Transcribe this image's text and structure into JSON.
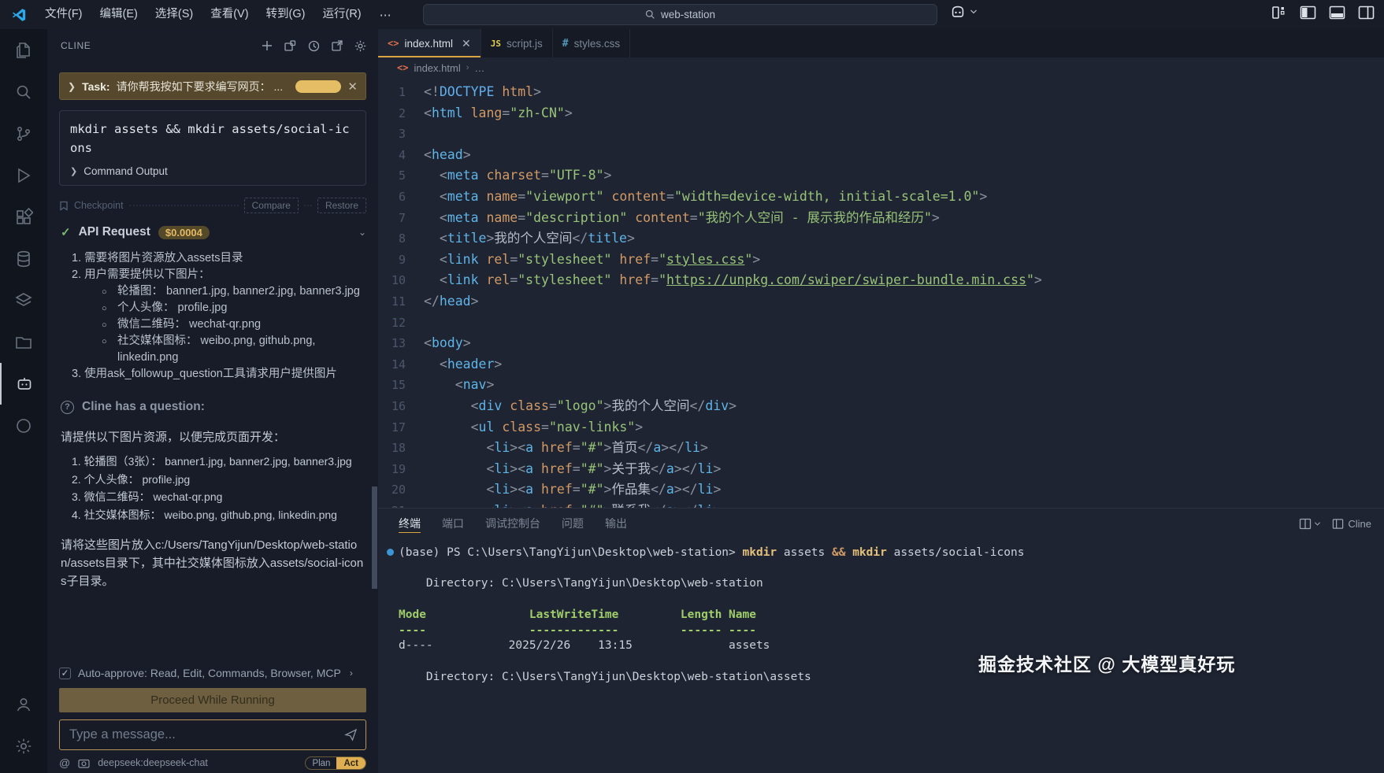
{
  "titlebar": {
    "menus": [
      "文件(F)",
      "编辑(E)",
      "选择(S)",
      "查看(V)",
      "转到(G)",
      "运行(R)"
    ],
    "more_label": "⋯",
    "search_value": "web-station"
  },
  "sidebar": {
    "title": "CLINE",
    "task": {
      "chevron": "❯",
      "label": "Task:",
      "text": "请你帮我按如下要求编写网页： ...",
      "cost_badge": "",
      "close": "✕"
    },
    "command": {
      "text": "mkdir assets && mkdir assets/social-icons",
      "output_chevron": "❯",
      "output_label": "Command Output"
    },
    "checkpoint": {
      "label": "Checkpoint",
      "compare": "Compare",
      "restore": "Restore"
    },
    "api_request": {
      "check": "✓",
      "label": "API Request",
      "cost": "$0.0004",
      "chevron": "⌄"
    },
    "plan_lines": [
      {
        "kind": "num",
        "text": "1. 需要将图片资源放入assets目录"
      },
      {
        "kind": "num",
        "text": "2. 用户需要提供以下图片："
      },
      {
        "kind": "bullet",
        "text": "轮播图： banner1.jpg, banner2.jpg, banner3.jpg"
      },
      {
        "kind": "bullet",
        "text": "个人头像： profile.jpg"
      },
      {
        "kind": "bullet",
        "text": "微信二维码： wechat-qr.png"
      },
      {
        "kind": "bullet",
        "text": "社交媒体图标： weibo.png, github.png, linkedin.png"
      },
      {
        "kind": "num",
        "text": "3. 使用ask_followup_question工具请求用户提供图片"
      }
    ],
    "question": {
      "icon": "?",
      "title": "Cline has a question:",
      "intro": "请提供以下图片资源，以便完成页面开发：",
      "items": [
        "1. 轮播图（3张）： banner1.jpg, banner2.jpg, banner3.jpg",
        "2. 个人头像： profile.jpg",
        "3. 微信二维码： wechat-qr.png",
        "4. 社交媒体图标： weibo.png, github.png, linkedin.png"
      ],
      "footer": "请将这些图片放入c:/Users/TangYijun/Desktop/web-station/assets目录下，其中社交媒体图标放入assets/social-icons子目录。"
    },
    "auto_approve": {
      "check": "✓",
      "label": "Auto-approve: Read, Edit, Commands, Browser, MCP",
      "chevron": "›"
    },
    "proceed_button": "Proceed While Running",
    "input_placeholder": "Type a message...",
    "footer": {
      "at": "@",
      "model": "deepseek:deepseek-chat",
      "plan": "Plan",
      "act": "Act"
    }
  },
  "editor": {
    "tabs": [
      {
        "label": "index.html",
        "icon": "html",
        "active": true,
        "close": "✕"
      },
      {
        "label": "script.js",
        "icon": "js",
        "active": false
      },
      {
        "label": "styles.css",
        "icon": "css",
        "active": false
      }
    ],
    "breadcrumb": {
      "icon": "html",
      "file": "index.html",
      "sep": "›",
      "more": "…"
    },
    "code_lines": [
      {
        "n": "1",
        "toks": [
          [
            "p",
            "<!"
          ],
          [
            "k",
            "DOCTYPE"
          ],
          [
            "a",
            " html"
          ],
          [
            "p",
            ">"
          ]
        ]
      },
      {
        "n": "2",
        "toks": [
          [
            "p",
            "<"
          ],
          [
            "t",
            "html"
          ],
          [
            "a",
            " lang"
          ],
          [
            "p",
            "="
          ],
          [
            "s",
            "\"zh-CN\""
          ],
          [
            "p",
            ">"
          ]
        ]
      },
      {
        "n": "3",
        "toks": []
      },
      {
        "n": "4",
        "toks": [
          [
            "p",
            "<"
          ],
          [
            "t",
            "head"
          ],
          [
            "p",
            ">"
          ]
        ]
      },
      {
        "n": "5",
        "toks": [
          [
            "w",
            "  "
          ],
          [
            "p",
            "<"
          ],
          [
            "t",
            "meta"
          ],
          [
            "a",
            " charset"
          ],
          [
            "p",
            "="
          ],
          [
            "s",
            "\"UTF-8\""
          ],
          [
            "p",
            ">"
          ]
        ]
      },
      {
        "n": "6",
        "toks": [
          [
            "w",
            "  "
          ],
          [
            "p",
            "<"
          ],
          [
            "t",
            "meta"
          ],
          [
            "a",
            " name"
          ],
          [
            "p",
            "="
          ],
          [
            "s",
            "\"viewport\""
          ],
          [
            "a",
            " content"
          ],
          [
            "p",
            "="
          ],
          [
            "s",
            "\"width=device-width, initial-scale=1.0\""
          ],
          [
            "p",
            ">"
          ]
        ]
      },
      {
        "n": "7",
        "toks": [
          [
            "w",
            "  "
          ],
          [
            "p",
            "<"
          ],
          [
            "t",
            "meta"
          ],
          [
            "a",
            " name"
          ],
          [
            "p",
            "="
          ],
          [
            "s",
            "\"description\""
          ],
          [
            "a",
            " content"
          ],
          [
            "p",
            "="
          ],
          [
            "s",
            "\"我的个人空间 - 展示我的作品和经历\""
          ],
          [
            "p",
            ">"
          ]
        ]
      },
      {
        "n": "8",
        "toks": [
          [
            "w",
            "  "
          ],
          [
            "p",
            "<"
          ],
          [
            "t",
            "title"
          ],
          [
            "p",
            ">"
          ],
          [
            "n",
            "我的个人空间"
          ],
          [
            "p",
            "</"
          ],
          [
            "t",
            "title"
          ],
          [
            "p",
            ">"
          ]
        ]
      },
      {
        "n": "9",
        "toks": [
          [
            "w",
            "  "
          ],
          [
            "p",
            "<"
          ],
          [
            "t",
            "link"
          ],
          [
            "a",
            " rel"
          ],
          [
            "p",
            "="
          ],
          [
            "s",
            "\"stylesheet\""
          ],
          [
            "a",
            " href"
          ],
          [
            "p",
            "="
          ],
          [
            "s",
            "\""
          ],
          [
            "u",
            "styles.css"
          ],
          [
            "s",
            "\""
          ],
          [
            "p",
            ">"
          ]
        ]
      },
      {
        "n": "10",
        "toks": [
          [
            "w",
            "  "
          ],
          [
            "p",
            "<"
          ],
          [
            "t",
            "link"
          ],
          [
            "a",
            " rel"
          ],
          [
            "p",
            "="
          ],
          [
            "s",
            "\"stylesheet\""
          ],
          [
            "a",
            " href"
          ],
          [
            "p",
            "="
          ],
          [
            "s",
            "\""
          ],
          [
            "u",
            "https://unpkg.com/swiper/swiper-bundle.min.css"
          ],
          [
            "s",
            "\""
          ],
          [
            "p",
            ">"
          ]
        ]
      },
      {
        "n": "11",
        "toks": [
          [
            "p",
            "</"
          ],
          [
            "t",
            "head"
          ],
          [
            "p",
            ">"
          ]
        ]
      },
      {
        "n": "12",
        "toks": []
      },
      {
        "n": "13",
        "toks": [
          [
            "p",
            "<"
          ],
          [
            "t",
            "body"
          ],
          [
            "p",
            ">"
          ]
        ]
      },
      {
        "n": "14",
        "toks": [
          [
            "w",
            "  "
          ],
          [
            "p",
            "<"
          ],
          [
            "t",
            "header"
          ],
          [
            "p",
            ">"
          ]
        ]
      },
      {
        "n": "15",
        "toks": [
          [
            "w",
            "    "
          ],
          [
            "p",
            "<"
          ],
          [
            "t",
            "nav"
          ],
          [
            "p",
            ">"
          ]
        ]
      },
      {
        "n": "16",
        "toks": [
          [
            "w",
            "      "
          ],
          [
            "p",
            "<"
          ],
          [
            "t",
            "div"
          ],
          [
            "a",
            " class"
          ],
          [
            "p",
            "="
          ],
          [
            "s",
            "\"logo\""
          ],
          [
            "p",
            ">"
          ],
          [
            "n",
            "我的个人空间"
          ],
          [
            "p",
            "</"
          ],
          [
            "t",
            "div"
          ],
          [
            "p",
            ">"
          ]
        ]
      },
      {
        "n": "17",
        "toks": [
          [
            "w",
            "      "
          ],
          [
            "p",
            "<"
          ],
          [
            "t",
            "ul"
          ],
          [
            "a",
            " class"
          ],
          [
            "p",
            "="
          ],
          [
            "s",
            "\"nav-links\""
          ],
          [
            "p",
            ">"
          ]
        ]
      },
      {
        "n": "18",
        "toks": [
          [
            "w",
            "        "
          ],
          [
            "p",
            "<"
          ],
          [
            "t",
            "li"
          ],
          [
            "p",
            "><"
          ],
          [
            "t",
            "a"
          ],
          [
            "a",
            " href"
          ],
          [
            "p",
            "="
          ],
          [
            "s",
            "\"#\""
          ],
          [
            "p",
            ">"
          ],
          [
            "n",
            "首页"
          ],
          [
            "p",
            "</"
          ],
          [
            "t",
            "a"
          ],
          [
            "p",
            "></"
          ],
          [
            "t",
            "li"
          ],
          [
            "p",
            ">"
          ]
        ]
      },
      {
        "n": "19",
        "toks": [
          [
            "w",
            "        "
          ],
          [
            "p",
            "<"
          ],
          [
            "t",
            "li"
          ],
          [
            "p",
            "><"
          ],
          [
            "t",
            "a"
          ],
          [
            "a",
            " href"
          ],
          [
            "p",
            "="
          ],
          [
            "s",
            "\"#\""
          ],
          [
            "p",
            ">"
          ],
          [
            "n",
            "关于我"
          ],
          [
            "p",
            "</"
          ],
          [
            "t",
            "a"
          ],
          [
            "p",
            "></"
          ],
          [
            "t",
            "li"
          ],
          [
            "p",
            ">"
          ]
        ]
      },
      {
        "n": "20",
        "toks": [
          [
            "w",
            "        "
          ],
          [
            "p",
            "<"
          ],
          [
            "t",
            "li"
          ],
          [
            "p",
            "><"
          ],
          [
            "t",
            "a"
          ],
          [
            "a",
            " href"
          ],
          [
            "p",
            "="
          ],
          [
            "s",
            "\"#\""
          ],
          [
            "p",
            ">"
          ],
          [
            "n",
            "作品集"
          ],
          [
            "p",
            "</"
          ],
          [
            "t",
            "a"
          ],
          [
            "p",
            "></"
          ],
          [
            "t",
            "li"
          ],
          [
            "p",
            ">"
          ]
        ]
      },
      {
        "n": "21",
        "toks": [
          [
            "w",
            "        "
          ],
          [
            "p",
            "<"
          ],
          [
            "t",
            "li"
          ],
          [
            "p",
            "><"
          ],
          [
            "t",
            "a"
          ],
          [
            "a",
            " href"
          ],
          [
            "p",
            "="
          ],
          [
            "s",
            "\"#\""
          ],
          [
            "p",
            ">"
          ],
          [
            "n",
            "联系我"
          ],
          [
            "p",
            "</"
          ],
          [
            "t",
            "a"
          ],
          [
            "p",
            "></"
          ],
          [
            "t",
            "li"
          ],
          [
            "p",
            ">"
          ]
        ]
      }
    ]
  },
  "terminal": {
    "tabs": [
      "终端",
      "端口",
      "调试控制台",
      "问题",
      "输出"
    ],
    "cline_label": "Cline",
    "lines": [
      {
        "dot": true,
        "toks": [
          [
            "w",
            "(base) PS C:\\Users\\TangYijun\\Desktop\\web-station> "
          ],
          [
            "y",
            "mkdir"
          ],
          [
            "w",
            " assets "
          ],
          [
            "r",
            "&&"
          ],
          [
            "w",
            " "
          ],
          [
            "y",
            "mkdir"
          ],
          [
            "w",
            " assets/social-icons"
          ]
        ]
      },
      {
        "toks": []
      },
      {
        "toks": [
          [
            "w",
            "    Directory: C:\\Users\\TangYijun\\Desktop\\web-station"
          ]
        ]
      },
      {
        "toks": []
      },
      {
        "toks": [
          [
            "g",
            "Mode               LastWriteTime         Length Name"
          ]
        ]
      },
      {
        "toks": [
          [
            "g",
            "----               -------------         ------ ----"
          ]
        ]
      },
      {
        "toks": [
          [
            "w",
            "d----           2025/2/26    13:15              assets"
          ]
        ]
      },
      {
        "toks": []
      },
      {
        "toks": [
          [
            "w",
            "    Directory: C:\\Users\\TangYijun\\Desktop\\web-station\\assets"
          ]
        ]
      }
    ]
  },
  "watermark": "掘金技术社区 @ 大模型真好玩"
}
